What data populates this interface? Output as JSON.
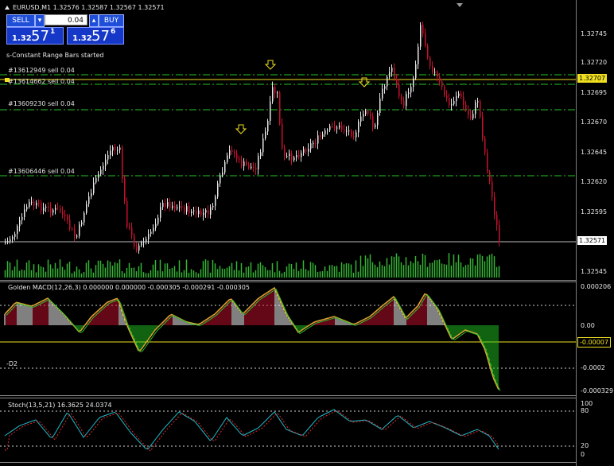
{
  "chart_title": "EURUSD,M1  1.32576 1.32587 1.32567 1.32571",
  "one_click": {
    "sell_label": "SELL",
    "buy_label": "BUY",
    "lot_value": "0.04",
    "sell_price_small": "1.32",
    "sell_price_big": "57",
    "sell_price_sup": "1",
    "buy_price_small": "1.32",
    "buy_price_big": "57",
    "buy_price_sup": "6"
  },
  "status_text": "s-Constant Range Bars started",
  "orders": [
    {
      "label": "#13612949 sell 0.04",
      "price": 1.32713
    },
    {
      "label": "#13614662 sell 0.04",
      "price": 1.32705
    },
    {
      "label": "#13609230 sell 0.04",
      "price": 1.32687
    },
    {
      "label": "#13606446 sell 0.04",
      "price": 1.3263
    }
  ],
  "price_axis": {
    "ticks": [
      "1.32745",
      "1.32720",
      "1.32695",
      "1.32670",
      "1.32645",
      "1.32620",
      "1.32595",
      "1.32570",
      "1.32545"
    ],
    "current_price": "1.32571",
    "marker_price": "1.32707"
  },
  "macd": {
    "label": "Golden MACD(12,26,3) 0.000000 0.000000 -0.000305 -0.000291 -0.000305",
    "ticks": [
      "0.000206",
      "0.00",
      "-0.0002",
      "-0.000329"
    ],
    "current": "-0.00007",
    "d2_label": "-D2"
  },
  "stoch": {
    "label": "Stoch(13,5,21) 16.3625 24.0374",
    "ticks": [
      "100",
      "80",
      "20",
      "0"
    ]
  },
  "colors": {
    "bull": "#e8e8e8",
    "bear": "#c8102e",
    "grid_green": "#22c322",
    "volume": "#35b535",
    "yellow": "#f0e020",
    "macd_signal": "#d2a830",
    "stoch_main": "#20b8c8",
    "stoch_signal": "#e02828",
    "button_blue": "#1f4fd8"
  },
  "arrows": [
    "down-arrow-icon",
    "down-arrow-icon",
    "down-arrow-icon"
  ]
}
